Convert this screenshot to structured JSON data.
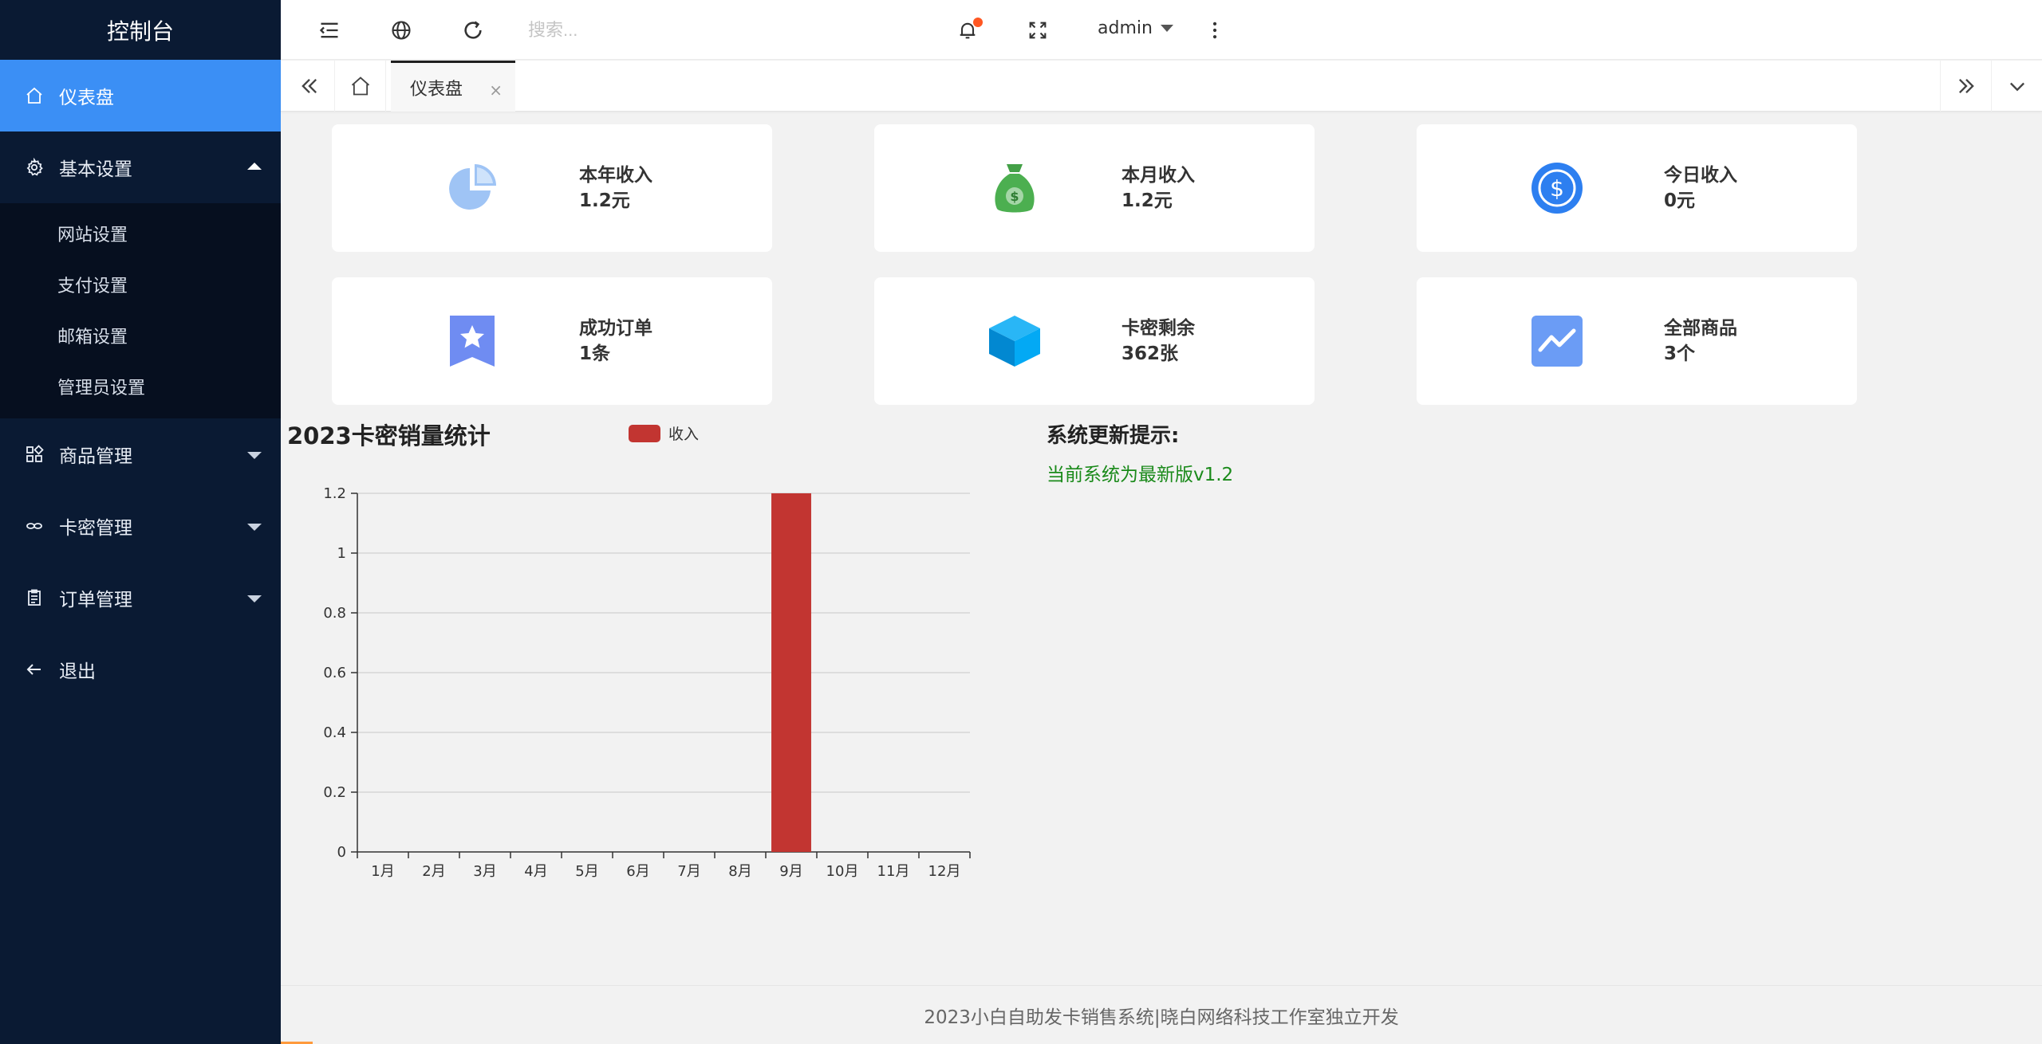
{
  "sidebar": {
    "brand": "控制台",
    "items": [
      {
        "label": "仪表盘",
        "icon": "home-icon",
        "active": true
      },
      {
        "label": "基本设置",
        "icon": "gear-icon",
        "expanded": true,
        "children": [
          "网站设置",
          "支付设置",
          "邮箱设置",
          "管理员设置"
        ]
      },
      {
        "label": "商品管理",
        "icon": "apps-icon"
      },
      {
        "label": "卡密管理",
        "icon": "link-icon"
      },
      {
        "label": "订单管理",
        "icon": "clipboard-icon"
      },
      {
        "label": "退出",
        "icon": "arrow-left-icon"
      }
    ]
  },
  "header": {
    "search_placeholder": "搜索...",
    "user": "admin"
  },
  "tabs": {
    "items": [
      {
        "label": "仪表盘",
        "close": "×"
      }
    ]
  },
  "stats": [
    {
      "label": "本年收入",
      "value": "1.2元",
      "icon": "pie-chart-icon"
    },
    {
      "label": "本月收入",
      "value": "1.2元",
      "icon": "money-bag-icon"
    },
    {
      "label": "今日收入",
      "value": "0元",
      "icon": "dollar-coin-icon"
    },
    {
      "label": "成功订单",
      "value": "1条",
      "icon": "star-bookmark-icon"
    },
    {
      "label": "卡密剩余",
      "value": "362张",
      "icon": "cube-icon"
    },
    {
      "label": "全部商品",
      "value": "3个",
      "icon": "trend-chart-icon"
    }
  ],
  "chart_data": {
    "type": "bar",
    "title": "2023卡密销量统计",
    "categories": [
      "1月",
      "2月",
      "3月",
      "4月",
      "5月",
      "6月",
      "7月",
      "8月",
      "9月",
      "10月",
      "11月",
      "12月"
    ],
    "series": [
      {
        "name": "收入",
        "values": [
          0,
          0,
          0,
          0,
          0,
          0,
          0,
          0,
          1.2,
          0,
          0,
          0
        ],
        "color": "#c23531"
      }
    ],
    "ylim": [
      0,
      1.2
    ],
    "yticks": [
      "0",
      "0.2",
      "0.4",
      "0.6",
      "0.8",
      "1",
      "1.2"
    ],
    "grid": true,
    "legend": "top-center"
  },
  "notice": {
    "title": "系统更新提示:",
    "text": "当前系统为最新版v1.2"
  },
  "footer": {
    "text": "2023小白自助发卡销售系统|晓白网络科技工作室独立开发"
  },
  "colors": {
    "sidebar_bg": "#0a1a33",
    "active": "#3b8ff5",
    "bar": "#c23531",
    "notice_green": "#1a8a1a"
  }
}
